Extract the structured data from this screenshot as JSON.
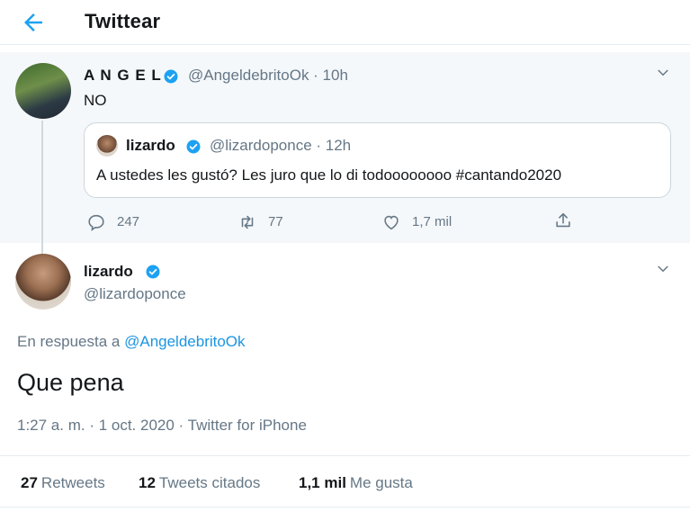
{
  "header": {
    "title": "Twittear",
    "back_icon": "arrow-left-icon"
  },
  "parent_tweet": {
    "author_name": "A N G E L",
    "verified": true,
    "handle_time": "@AngeldebritoOk · 10h",
    "text": "NO",
    "quoted": {
      "author_name": "lizardo",
      "verified": true,
      "handle_time": "@lizardoponce · 12h",
      "text": "A ustedes les gustó? Les juro que lo di todoooooooo #cantando2020"
    },
    "actions": {
      "replies": "247",
      "retweets": "77",
      "likes": "1,7 mil"
    }
  },
  "main_tweet": {
    "author_name": "lizardo",
    "verified": true,
    "handle": "@lizardoponce",
    "reply_prefix": "En respuesta a",
    "reply_to": "@AngeldebritoOk",
    "text": "Que pena",
    "meta": "1:27 a. m. · 1 oct. 2020 · Twitter for iPhone",
    "stats": {
      "retweets_count": "27",
      "retweets_label": "Retweets",
      "quotes_count": "12",
      "quotes_label": "Tweets citados",
      "likes_count": "1,1 mil",
      "likes_label": "Me gusta"
    }
  },
  "colors": {
    "accent": "#1da1f2",
    "verified": "#1da1f2",
    "muted": "#657786"
  }
}
